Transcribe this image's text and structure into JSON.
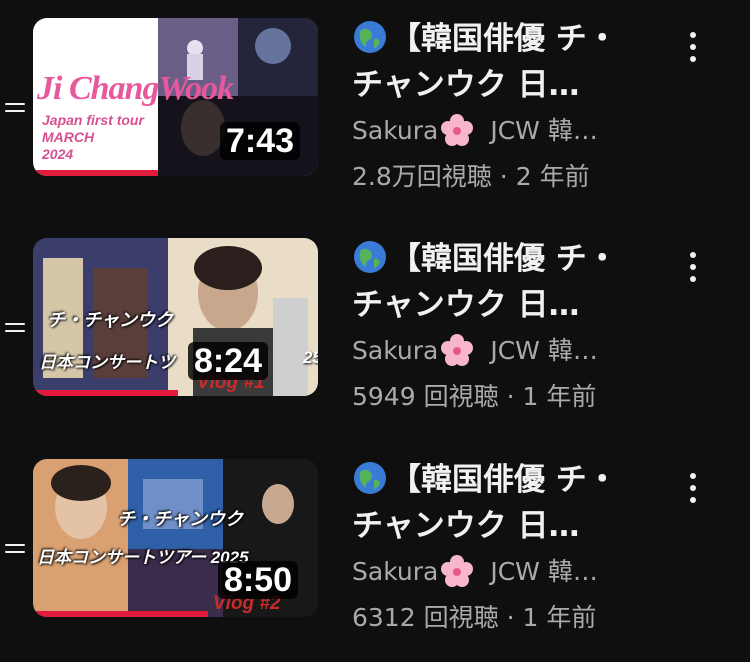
{
  "videos": [
    {
      "title_line1": "【韓国俳優 チ・",
      "title_line2": "チャンウク 日…",
      "channel_name": "Sakura",
      "channel_suffix": "JCW 韓…",
      "views": "2.8万回視聴",
      "separator": "·",
      "age": "2 年前",
      "duration": "7:43",
      "thumb_text": {
        "script": "Ji ChangWook",
        "line1": "Japan first tour",
        "line2": "MARCH",
        "line3": "2024"
      }
    },
    {
      "title_line1": "【韓国俳優 チ・",
      "title_line2": "チャンウク 日…",
      "channel_name": "Sakura",
      "channel_suffix": "JCW 韓…",
      "views": "5949 回視聴",
      "separator": "·",
      "age": "1 年前",
      "duration": "8:24",
      "thumb_text": {
        "line1": "チ・チャンウク",
        "line2": "日本コンサートツ",
        "year": "25",
        "vlog": "Vlog #1"
      }
    },
    {
      "title_line1": "【韓国俳優 チ・",
      "title_line2": "チャンウク 日…",
      "channel_name": "Sakura",
      "channel_suffix": "JCW 韓…",
      "views": "6312 回視聴",
      "separator": "·",
      "age": "1 年前",
      "duration": "8:50",
      "thumb_text": {
        "line1": "チ・チャンウク",
        "line2": "日本コンサートツアー 2025",
        "vlog": "Vlog #2"
      }
    }
  ],
  "icons": {
    "drag": "drag-handle-icon",
    "more": "more-vert-icon",
    "globe": "globe-asia-emoji-icon",
    "blossom": "cherry-blossom-emoji-icon"
  },
  "colors": {
    "background": "#0f0f0f",
    "text_primary": "#f1f1f1",
    "text_secondary": "#aaaaaa"
  }
}
